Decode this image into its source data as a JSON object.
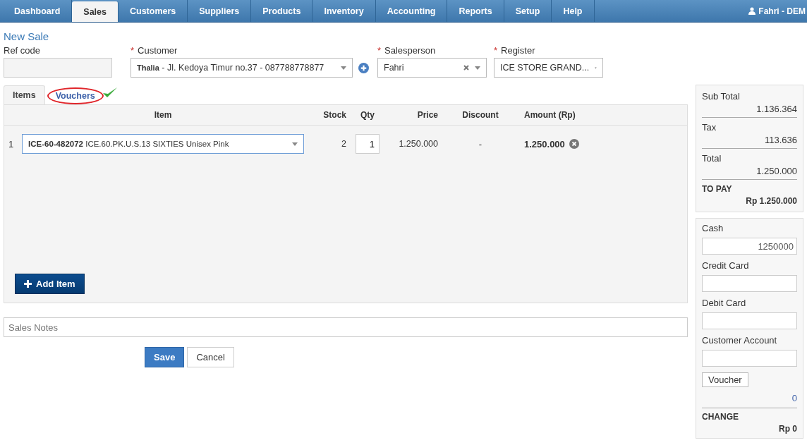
{
  "nav": {
    "tabs": [
      {
        "label": "Dashboard",
        "selected": false
      },
      {
        "label": "Sales",
        "selected": true
      },
      {
        "label": "Customers",
        "selected": false
      },
      {
        "label": "Suppliers",
        "selected": false
      },
      {
        "label": "Products",
        "selected": false
      },
      {
        "label": "Inventory",
        "selected": false
      },
      {
        "label": "Accounting",
        "selected": false
      },
      {
        "label": "Reports",
        "selected": false
      },
      {
        "label": "Setup",
        "selected": false
      },
      {
        "label": "Help",
        "selected": false
      }
    ],
    "user": "Fahri - DEM"
  },
  "page_title": "New Sale",
  "fields": [
    {
      "label": "Ref code",
      "kind": "text"
    },
    {
      "label": "Customer",
      "required_mark": "*",
      "kind": "select_add",
      "value": "**Thalia** - Jl. Kedoya Timur no.37 - 087788778877"
    },
    {
      "label": "Salesperson",
      "required_mark": "*",
      "kind": "select_clear",
      "value": "Fahri"
    },
    {
      "label": "Register",
      "required_mark": "*",
      "kind": "select",
      "value": "ICE STORE GRAND..."
    }
  ],
  "tabs": [
    {
      "label": "Items",
      "selected": true,
      "annotated": false
    },
    {
      "label": "Vouchers",
      "selected": false,
      "annotated": true
    }
  ],
  "table": {
    "columns": [
      "Item",
      "Stock",
      "Qty",
      "Price",
      "Discount",
      "Amount (Rp)"
    ],
    "rows": [
      {
        "no": "1",
        "item": "**ICE-60-482072** ICE.60.PK.U.S.13 SIXTIES Unisex Pink",
        "stock": "2",
        "qty": "1",
        "price": "1.250.000",
        "discount": "-",
        "amount": "1.250.000"
      }
    ]
  },
  "add_item": "Add Item",
  "notes_placeholder": "Sales Notes",
  "buttons": [
    "Save",
    "Cancel"
  ],
  "summary": [
    {
      "label": "Sub Total",
      "value": "1.136.364",
      "kind": "line"
    },
    {
      "label": "Tax",
      "value": "113.636",
      "kind": "line"
    },
    {
      "label": "Total",
      "value": "1.250.000",
      "kind": "line"
    },
    {
      "label": "TO PAY",
      "value": "Rp 1.250.000",
      "kind": "total"
    }
  ],
  "payments": [
    {
      "label": "Cash",
      "value": "1250000"
    },
    {
      "label": "Credit Card"
    },
    {
      "label": "Debit Card"
    },
    {
      "label": "Customer Account"
    }
  ],
  "voucher_button": "Voucher",
  "voucher_value": "0",
  "change": {
    "label": "CHANGE",
    "value": "Rp 0"
  }
}
